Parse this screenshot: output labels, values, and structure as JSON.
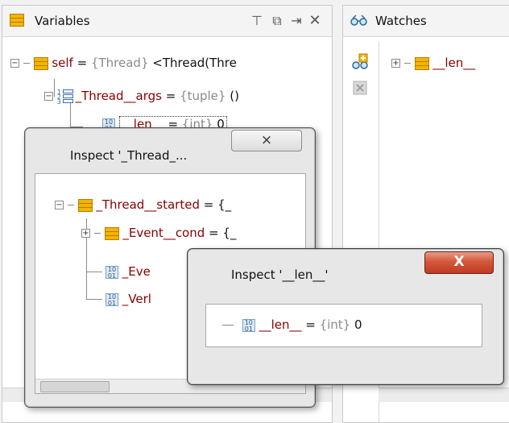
{
  "variables_panel": {
    "title": "Variables",
    "tree": [
      {
        "name": "self",
        "eq": " = ",
        "type": "{Thread}",
        "value": " <Thread(Thre"
      },
      {
        "name": "_Thread__args",
        "eq": " = ",
        "type": "{tuple}",
        "value": " ()"
      },
      {
        "name": "__len__",
        "eq": " = ",
        "type": "{int}",
        "value": " 0"
      }
    ]
  },
  "watches_panel": {
    "title": "Watches",
    "tree": [
      {
        "name": "__len__"
      }
    ]
  },
  "inspect_thread": {
    "title": "Inspect '_Thread_...",
    "close_label": "⨯",
    "tree": [
      {
        "name": "_Thread__started",
        "eq": " = ",
        "type": "{_"
      },
      {
        "name": "_Event__cond",
        "eq": " = ",
        "type": "{_"
      },
      {
        "name": "_Eve"
      },
      {
        "name": "_Verl"
      }
    ]
  },
  "inspect_len": {
    "title": "Inspect '__len__'",
    "close_label": "X",
    "tree": [
      {
        "name": "__len__",
        "eq": " = ",
        "type": "{int}",
        "value": " 0"
      }
    ]
  },
  "icons": {
    "variable": "variable-stack-icon",
    "int": "int-type-icon",
    "tuple": "tuple-type-icon",
    "watch": "watch-glasses-icon",
    "add_watch": "add-watch-icon",
    "remove_watch": "remove-watch-icon"
  },
  "colors": {
    "variable_name": "#8a0000",
    "type_text": "#8b8b8b",
    "close_active": "#c03b21"
  }
}
